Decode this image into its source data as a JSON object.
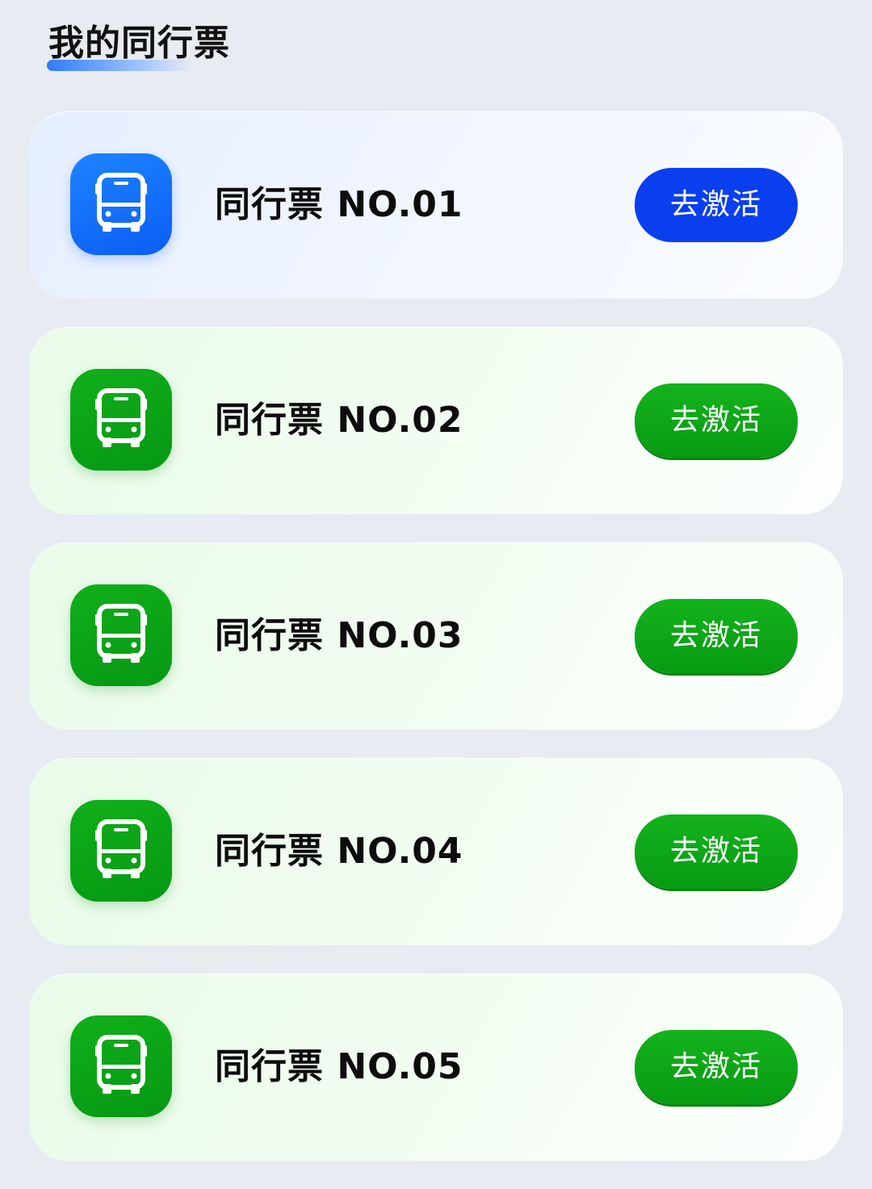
{
  "header": {
    "title": "我的同行票"
  },
  "colors": {
    "primary_blue": "#0a3ff0",
    "primary_green": "#0aa516",
    "page_bg": "#e7ebf2"
  },
  "tickets": [
    {
      "name": "同行票 NO.01",
      "button_label": "去激活",
      "icon": "bus-icon",
      "theme": "blue"
    },
    {
      "name": "同行票 NO.02",
      "button_label": "去激活",
      "icon": "bus-icon",
      "theme": "green"
    },
    {
      "name": "同行票 NO.03",
      "button_label": "去激活",
      "icon": "bus-icon",
      "theme": "green"
    },
    {
      "name": "同行票 NO.04",
      "button_label": "去激活",
      "icon": "bus-icon",
      "theme": "green"
    },
    {
      "name": "同行票 NO.05",
      "button_label": "去激活",
      "icon": "bus-icon",
      "theme": "green"
    }
  ]
}
